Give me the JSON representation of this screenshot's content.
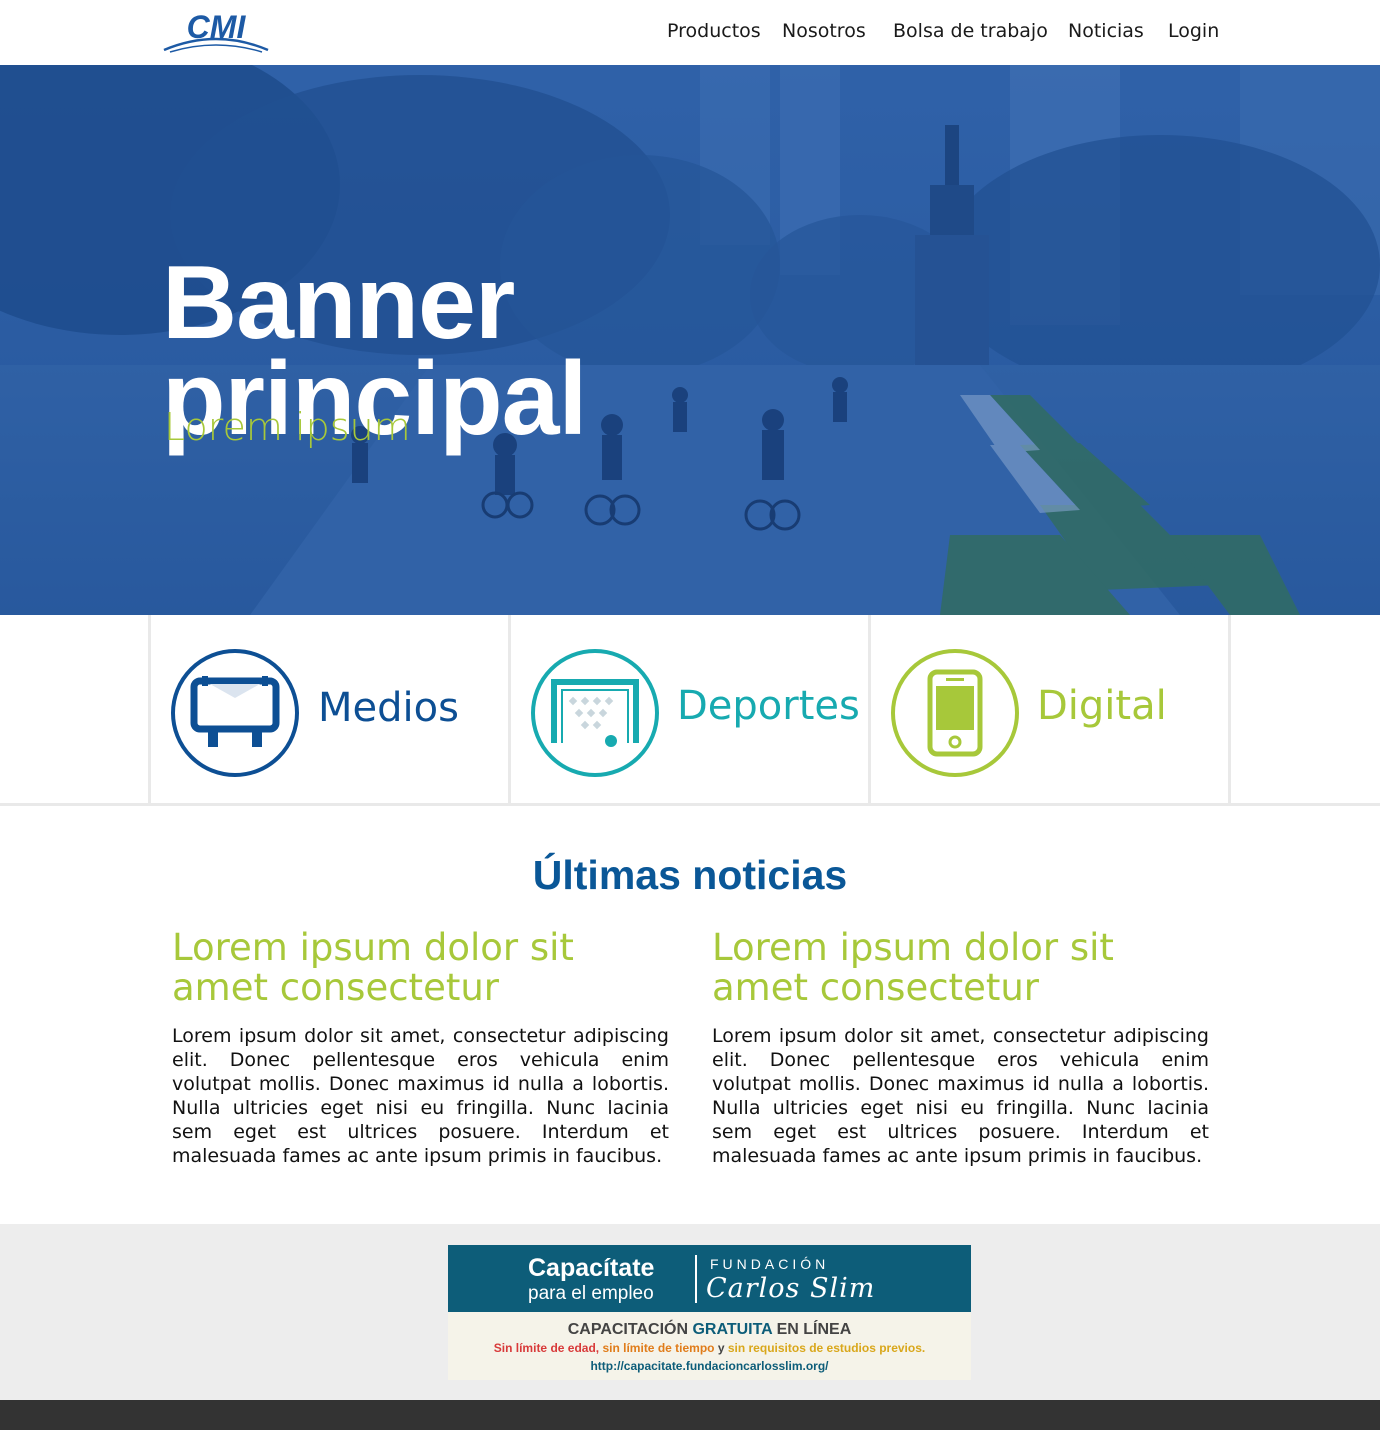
{
  "header": {
    "logo_text": "CMI",
    "nav": [
      "Productos",
      "Nosotros",
      "Bolsa de trabajo",
      "Noticias",
      "Login"
    ]
  },
  "hero": {
    "title_line1": "Banner",
    "title_line2": "principal",
    "subtitle": "Lorem ipsum"
  },
  "categories": [
    {
      "label": "Medios",
      "color": "#0d4f94",
      "icon": "billboard-icon"
    },
    {
      "label": "Deportes",
      "color": "#17aab0",
      "icon": "soccer-goal-icon"
    },
    {
      "label": "Digital",
      "color": "#a7c83a",
      "icon": "smartphone-icon"
    }
  ],
  "news": {
    "title": "Últimas noticias",
    "items": [
      {
        "headline": "Lorem ipsum dolor sit amet consectetur",
        "body": "Lorem ipsum dolor sit amet, consectetur adipiscing elit. Donec pellentesque eros vehicula enim volutpat mollis. Donec maximus id nulla a lobortis. Nulla ultricies eget nisi eu fringilla. Nunc lacinia sem eget est ultrices posuere. Interdum et malesuada fames ac ante ipsum primis in faucibus."
      },
      {
        "headline": "Lorem ipsum dolor sit amet consectetur",
        "body": "Lorem ipsum dolor sit amet, consectetur adipiscing elit. Donec pellentesque eros vehicula enim volutpat mollis. Donec maximus id nulla a lobortis. Nulla ultricies eget nisi eu fringilla. Nunc lacinia sem eget est ultrices posuere. Interdum et malesuada fames ac ante ipsum primis in faucibus."
      }
    ]
  },
  "ad": {
    "cap_line1": "Capacítate",
    "cap_line2": "para el empleo",
    "fundacion": "FUNDACIÓN",
    "carlos": "Carlos Slim",
    "line1_a": "CAPACITACIÓN ",
    "line1_b": "GRATUITA",
    "line1_c": " EN LÍNEA",
    "line2_a": "Sin límite de edad, ",
    "line2_b": "sin límite de tiempo",
    "line2_c": " y ",
    "line2_d": "sin requisitos de estudios previos.",
    "url": "http://capacitate.fundacioncarlosslim.org/"
  }
}
